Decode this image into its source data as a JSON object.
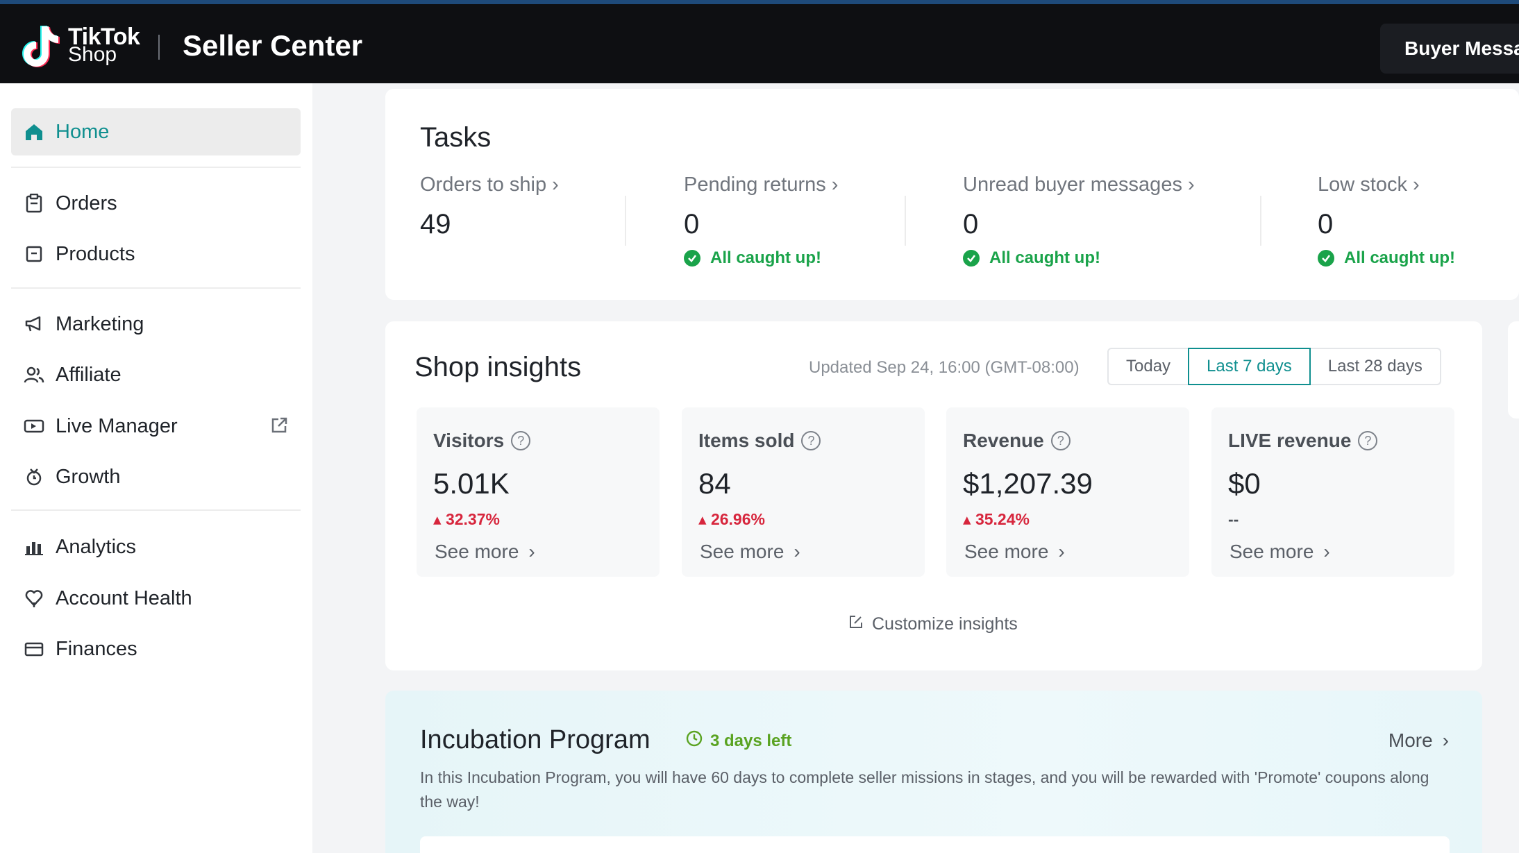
{
  "header": {
    "logo_line1": "TikTok",
    "logo_line2": "Shop",
    "title": "Seller Center",
    "buyer_messages": "Buyer Messa"
  },
  "sidebar": {
    "items": [
      {
        "label": "Home",
        "icon": "home-icon",
        "active": true
      },
      {
        "label": "Orders",
        "icon": "clipboard-icon"
      },
      {
        "label": "Products",
        "icon": "box-icon"
      },
      {
        "label": "Marketing",
        "icon": "megaphone-icon"
      },
      {
        "label": "Affiliate",
        "icon": "people-icon"
      },
      {
        "label": "Live Manager",
        "icon": "video-icon",
        "external": true
      },
      {
        "label": "Growth",
        "icon": "growth-icon"
      },
      {
        "label": "Analytics",
        "icon": "bar-chart-icon"
      },
      {
        "label": "Account Health",
        "icon": "shield-heart-icon"
      },
      {
        "label": "Finances",
        "icon": "wallet-icon"
      }
    ]
  },
  "tasks": {
    "title": "Tasks",
    "items": [
      {
        "label": "Orders to ship ›",
        "value": "49",
        "status": ""
      },
      {
        "label": "Pending returns ›",
        "value": "0",
        "status": "All caught up!"
      },
      {
        "label": "Unread buyer messages ›",
        "value": "0",
        "status": "All caught up!"
      },
      {
        "label": "Low stock ›",
        "value": "0",
        "status": "All caught up!"
      }
    ]
  },
  "insights": {
    "title": "Shop insights",
    "updated": "Updated Sep 24, 16:00 (GMT-08:00)",
    "ranges": [
      "Today",
      "Last 7 days",
      "Last 28 days"
    ],
    "selected_range": "Last 7 days",
    "metrics": [
      {
        "label": "Visitors",
        "value": "5.01K",
        "change": "32.37%",
        "more": "See more"
      },
      {
        "label": "Items sold",
        "value": "84",
        "change": "26.96%",
        "more": "See more"
      },
      {
        "label": "Revenue",
        "value": "$1,207.39",
        "change": "35.24%",
        "more": "See more"
      },
      {
        "label": "LIVE revenue",
        "value": "$0",
        "change": "--",
        "more": "See more"
      }
    ],
    "customize": "Customize insights"
  },
  "incubation": {
    "title": "Incubation Program",
    "badge": "3 days left",
    "more": "More",
    "description": "In this Incubation Program, you will have 60 days to complete seller missions in stages, and you will be rewarded with 'Promote' coupons along the way!"
  },
  "colors": {
    "accent": "#0f8f8f",
    "success": "#1aa34a",
    "increase": "#d7263d",
    "topbar": "#0e0f12"
  }
}
